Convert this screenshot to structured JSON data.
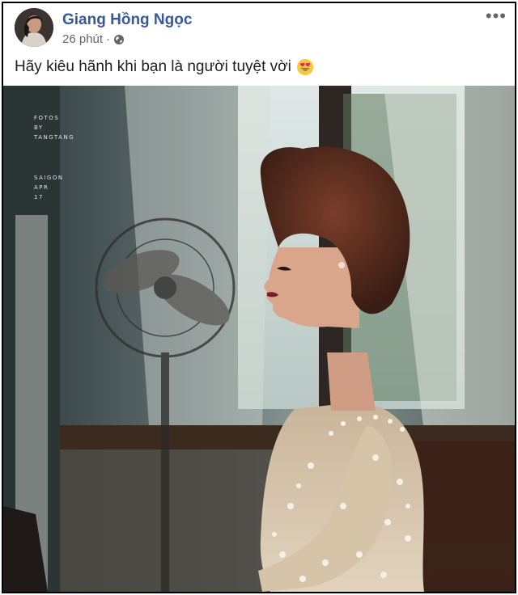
{
  "post": {
    "author": "Giang Hồng Ngọc",
    "time": "26 phút",
    "separator": "·",
    "privacy_icon": "globe-icon",
    "more_icon": "more-options-icon",
    "more_label": "•••",
    "caption": "Hãy kiêu hãnh khi bạn là người tuyệt vời",
    "caption_emoji": "heart-eyes-emoji"
  },
  "photo": {
    "credit_lines": [
      "FOTOS",
      "BY",
      "TANGTANG"
    ],
    "place_lines": [
      "SAIGON",
      "APR",
      "17"
    ]
  },
  "colors": {
    "author": "#385898",
    "meta": "#606770",
    "text": "#1c1e21"
  }
}
